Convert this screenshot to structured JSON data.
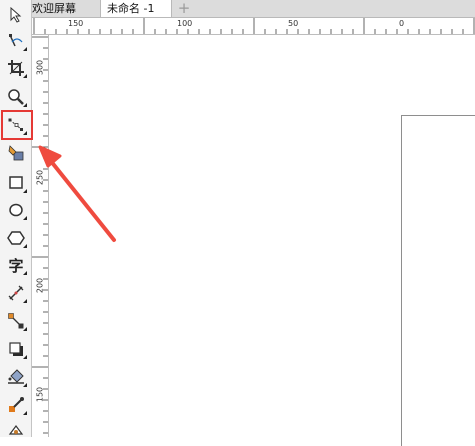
{
  "tabs": [
    {
      "label": "欢迎屏幕",
      "active": false
    },
    {
      "label": "未命名 -1",
      "active": true
    }
  ],
  "add_tab_label": "+",
  "ruler_top": {
    "labels": [
      "150",
      "100",
      "50",
      "0"
    ]
  },
  "ruler_left": {
    "labels": [
      "300",
      "250",
      "200",
      "150"
    ]
  },
  "toolbox": {
    "tools": [
      {
        "name": "pick-tool",
        "icon": "cursor-arrow-icon"
      },
      {
        "name": "shape-tool",
        "icon": "shape-node-icon"
      },
      {
        "name": "crop-tool",
        "icon": "crop-icon"
      },
      {
        "name": "zoom-tool",
        "icon": "magnifier-icon"
      },
      {
        "name": "connector-tool",
        "icon": "connector-line-icon",
        "highlighted": true
      },
      {
        "name": "smart-fill-tool",
        "icon": "smart-fill-icon"
      },
      {
        "name": "rectangle-tool",
        "icon": "rectangle-icon"
      },
      {
        "name": "ellipse-tool",
        "icon": "ellipse-icon"
      },
      {
        "name": "polygon-tool",
        "icon": "hexagon-icon"
      },
      {
        "name": "text-tool",
        "icon": "text-icon",
        "label": "字"
      },
      {
        "name": "parallel-dimension-tool",
        "icon": "dimension-icon"
      },
      {
        "name": "straight-line-connector-tool",
        "icon": "line-connector-icon"
      },
      {
        "name": "drop-shadow-tool",
        "icon": "drop-shadow-icon"
      },
      {
        "name": "interactive-fill-tool",
        "icon": "paint-bucket-icon"
      },
      {
        "name": "eyedropper-tool",
        "icon": "eyedropper-icon"
      },
      {
        "name": "smart-drawing-tool",
        "icon": "smart-drawing-icon"
      }
    ]
  },
  "colors": {
    "highlight": "#e53935",
    "toolbar_bg": "#f4f4f4",
    "tab_bar_bg": "#dcdcdc"
  }
}
